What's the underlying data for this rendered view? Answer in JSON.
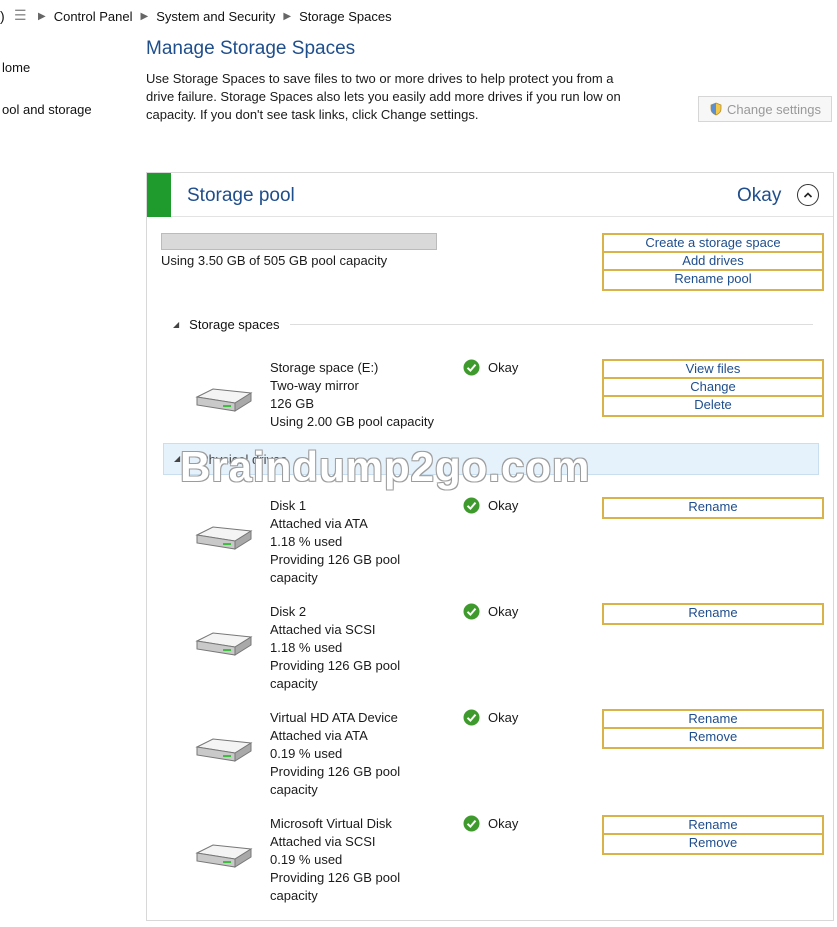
{
  "breadcrumb": {
    "clipped_char": ")",
    "items": [
      "Control Panel",
      "System and Security",
      "Storage Spaces"
    ]
  },
  "leftnav": {
    "items": [
      "lome",
      "ool and storage"
    ]
  },
  "header": {
    "title": "Manage Storage Spaces",
    "desc_line1": "Use Storage Spaces to save files to two or more drives to help protect you from a",
    "desc_line2": "drive failure. Storage Spaces also lets you easily add more drives if you run low on",
    "desc_line3": "capacity. If you don't see task links, click Change settings.",
    "change_settings_label": "Change settings"
  },
  "pool": {
    "title": "Storage pool",
    "status": "Okay",
    "capacity_used_fraction": 0.0,
    "capacity_text": "Using 3.50 GB of 505 GB pool capacity",
    "links": [
      "Create a storage space",
      "Add drives",
      "Rename pool"
    ]
  },
  "storage_spaces": {
    "section_label": "Storage spaces",
    "items": [
      {
        "lines": [
          "Storage space (E:)",
          "Two-way mirror",
          "126 GB",
          "Using 2.00 GB pool capacity"
        ],
        "status": "Okay",
        "links": [
          "View files",
          "Change",
          "Delete"
        ]
      }
    ]
  },
  "physical_drives": {
    "section_label": "Physical drives",
    "items": [
      {
        "lines": [
          "Disk 1",
          "Attached via ATA",
          "1.18 % used",
          "Providing 126 GB pool",
          "capacity"
        ],
        "status": "Okay",
        "links": [
          "Rename"
        ]
      },
      {
        "lines": [
          "Disk 2",
          "Attached via SCSI",
          "1.18 % used",
          "Providing 126 GB pool",
          "capacity"
        ],
        "status": "Okay",
        "links": [
          "Rename"
        ]
      },
      {
        "lines": [
          "Virtual HD ATA Device",
          "Attached via ATA",
          "0.19 % used",
          "Providing 126 GB pool",
          "capacity"
        ],
        "status": "Okay",
        "links": [
          "Rename",
          "Remove"
        ]
      },
      {
        "lines": [
          "Microsoft Virtual Disk",
          "Attached via SCSI",
          "0.19 % used",
          "Providing 126 GB pool",
          "capacity"
        ],
        "status": "Okay",
        "links": [
          "Rename",
          "Remove"
        ]
      }
    ]
  },
  "watermark": "Braindump2go.com",
  "colors": {
    "accent_blue": "#1f4e8c",
    "status_green": "#1f9a2d",
    "link_box_border": "#d9b24a",
    "highlight_band": "#e5f1fb"
  },
  "icons": {
    "breadcrumb": "storage-db-icon",
    "change_settings": "uac-shield-icon",
    "collapse": "chevron-up-circle-icon",
    "status": "green-check-icon",
    "drive": "hard-drive-icon"
  }
}
